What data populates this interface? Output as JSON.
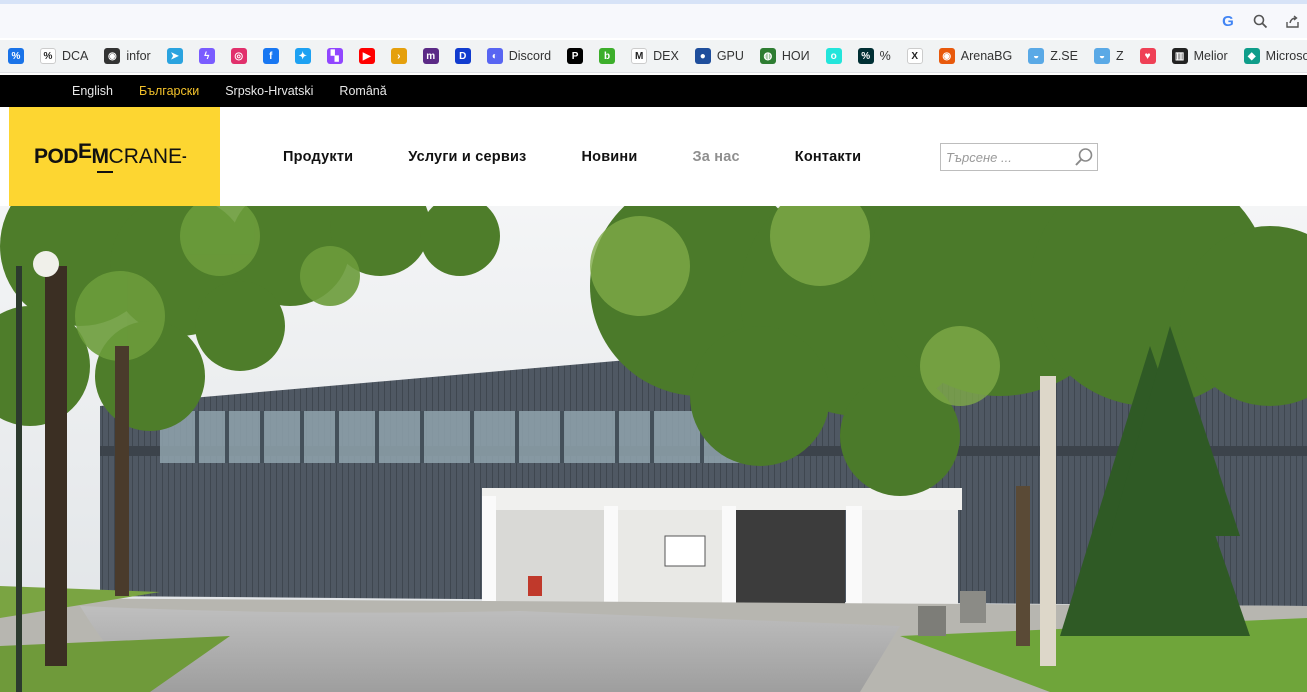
{
  "browser": {
    "toolbar_icons": [
      "google-icon",
      "zoom-icon",
      "share-icon"
    ],
    "bookmarks": [
      {
        "label": "",
        "icon": "percent-icon",
        "color": "#1a73e8",
        "glyph": "%"
      },
      {
        "label": "DCA",
        "icon": "percent-icon",
        "color": "#ffffff",
        "glyph": "%"
      },
      {
        "label": "infor",
        "icon": "globe-icon",
        "color": "#333333",
        "glyph": "◉"
      },
      {
        "label": "",
        "icon": "telegram-icon",
        "color": "#2aa3df",
        "glyph": "➤"
      },
      {
        "label": "",
        "icon": "messenger-icon",
        "color": "#7a5cff",
        "glyph": "ϟ"
      },
      {
        "label": "",
        "icon": "instagram-icon",
        "color": "#e1306c",
        "glyph": "◎"
      },
      {
        "label": "",
        "icon": "facebook-icon",
        "color": "#1877f2",
        "glyph": "f"
      },
      {
        "label": "",
        "icon": "twitter-icon",
        "color": "#1da1f2",
        "glyph": "✦"
      },
      {
        "label": "",
        "icon": "twitch-icon",
        "color": "#9146ff",
        "glyph": "▚"
      },
      {
        "label": "",
        "icon": "youtube-icon",
        "color": "#ff0000",
        "glyph": "▶"
      },
      {
        "label": "",
        "icon": "plex-icon",
        "color": "#e5a00d",
        "glyph": "›"
      },
      {
        "label": "",
        "icon": "m-icon",
        "color": "#5b2a86",
        "glyph": "m"
      },
      {
        "label": "",
        "icon": "disney-icon",
        "color": "#113ccf",
        "glyph": "D"
      },
      {
        "label": "Discord",
        "icon": "discord-icon",
        "color": "#5865f2",
        "glyph": "◐"
      },
      {
        "label": "",
        "icon": "patreon-icon",
        "color": "#000000",
        "glyph": "P"
      },
      {
        "label": "",
        "icon": "b-icon",
        "color": "#3dae2b",
        "glyph": "b"
      },
      {
        "label": "DEX",
        "icon": "dex-icon",
        "color": "#ffffff",
        "glyph": "M"
      },
      {
        "label": "GPU",
        "icon": "globe-icon",
        "color": "#1f4e9c",
        "glyph": "●"
      },
      {
        "label": "НОИ",
        "icon": "noi-icon",
        "color": "#2e7d32",
        "glyph": "◍"
      },
      {
        "label": "",
        "icon": "olx-icon",
        "color": "#23e5db",
        "glyph": "o"
      },
      {
        "label": "%",
        "icon": "percent-icon",
        "color": "#002f34",
        "glyph": "%"
      },
      {
        "label": "",
        "icon": "x-icon",
        "color": "#ffffff",
        "glyph": "X"
      },
      {
        "label": "ArenaBG",
        "icon": "arenabg-icon",
        "color": "#e8590c",
        "glyph": "◉"
      },
      {
        "label": "Z.SE",
        "icon": "drop-icon",
        "color": "#5aa9e6",
        "glyph": "◒"
      },
      {
        "label": "Z",
        "icon": "drop-icon",
        "color": "#5aa9e6",
        "glyph": "◒"
      },
      {
        "label": "",
        "icon": "pocket-icon",
        "color": "#ef4056",
        "glyph": "♥"
      },
      {
        "label": "Melior",
        "icon": "melior-icon",
        "color": "#222222",
        "glyph": "▥"
      },
      {
        "label": "Microsof",
        "icon": "gem-icon",
        "color": "#0f9d8a",
        "glyph": "◆"
      }
    ]
  },
  "site": {
    "languages": [
      {
        "label": "English",
        "active": false
      },
      {
        "label": "Български",
        "active": true
      },
      {
        "label": "Srpsko-Hrvatski",
        "active": false
      },
      {
        "label": "Română",
        "active": false
      }
    ],
    "logo": {
      "pod": "POD",
      "e": "E",
      "m": "M",
      "crane": "CRANE",
      "dash": "-"
    },
    "nav": [
      {
        "label": "Продукти",
        "muted": false
      },
      {
        "label": "Услуги и сервиз",
        "muted": false
      },
      {
        "label": "Новини",
        "muted": false
      },
      {
        "label": "За нас",
        "muted": true
      },
      {
        "label": "Контакти",
        "muted": false
      }
    ],
    "search": {
      "placeholder": "Търсене ..."
    },
    "colors": {
      "brand_yellow": "#fdd631",
      "lang_active": "#f3c22b"
    }
  }
}
